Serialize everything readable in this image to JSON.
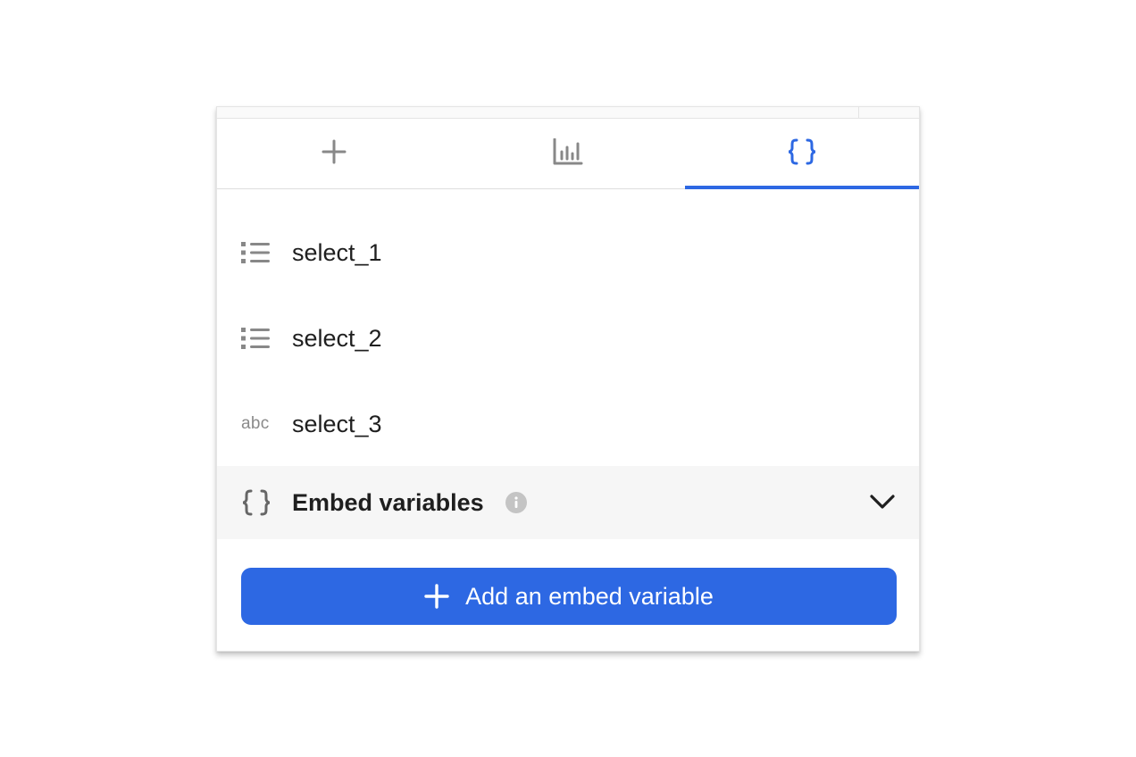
{
  "tabs": [
    {
      "icon": "plus-icon",
      "active": false
    },
    {
      "icon": "chart-icon",
      "active": false
    },
    {
      "icon": "braces-icon",
      "active": true
    }
  ],
  "fields": [
    {
      "icon": "list-icon",
      "label": "select_1"
    },
    {
      "icon": "list-icon",
      "label": "select_2"
    },
    {
      "icon": "text-type-icon",
      "type_text": "abc",
      "label": "select_3"
    }
  ],
  "embed": {
    "icon": "braces-icon",
    "title": "Embed variables",
    "expanded": true
  },
  "add_button": {
    "label": "Add an embed variable"
  },
  "colors": {
    "accent": "#2d68e3",
    "icon_gray": "#888888",
    "text": "#1f1f1f",
    "section_bg": "#f6f6f6"
  }
}
